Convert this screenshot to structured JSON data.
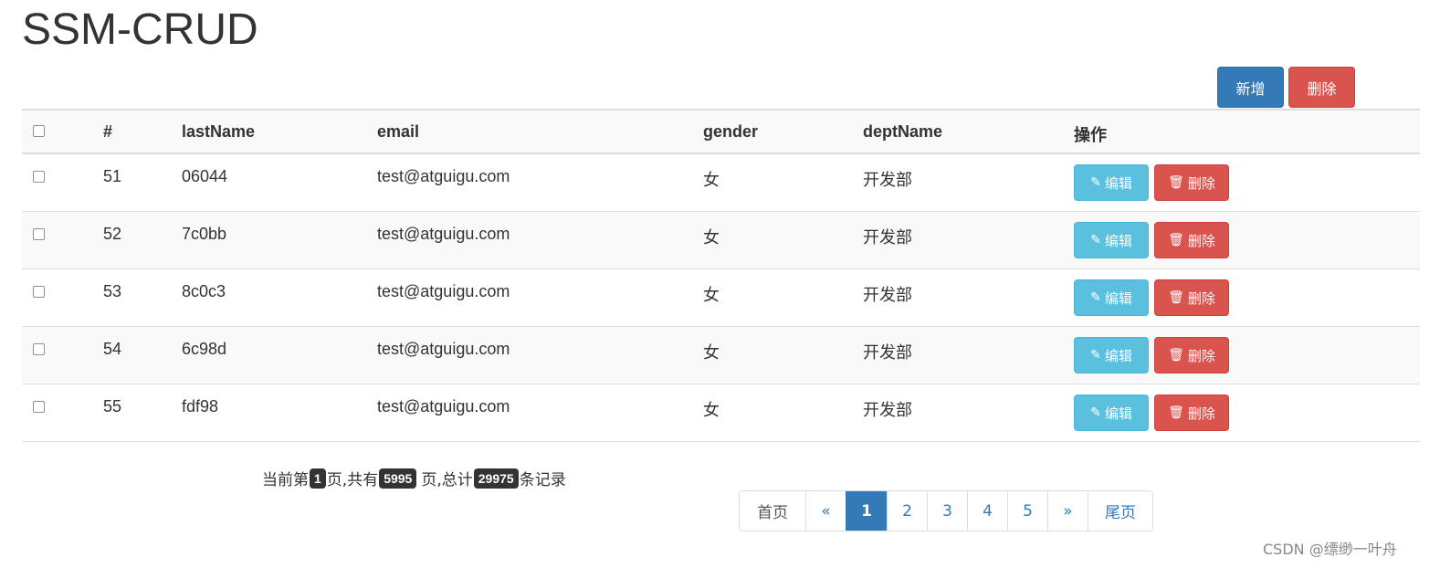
{
  "title": "SSM-CRUD",
  "toolbar": {
    "add_label": "新增",
    "delete_label": "删除"
  },
  "table": {
    "headers": [
      "#",
      "lastName",
      "email",
      "gender",
      "deptName",
      "操作"
    ],
    "rows": [
      {
        "id": "51",
        "lastName": "06044",
        "email": "test@atguigu.com",
        "gender": "女",
        "deptName": "开发部"
      },
      {
        "id": "52",
        "lastName": "7c0bb",
        "email": "test@atguigu.com",
        "gender": "女",
        "deptName": "开发部"
      },
      {
        "id": "53",
        "lastName": "8c0c3",
        "email": "test@atguigu.com",
        "gender": "女",
        "deptName": "开发部"
      },
      {
        "id": "54",
        "lastName": "6c98d",
        "email": "test@atguigu.com",
        "gender": "女",
        "deptName": "开发部"
      },
      {
        "id": "55",
        "lastName": "fdf98",
        "email": "test@atguigu.com",
        "gender": "女",
        "deptName": "开发部"
      }
    ],
    "edit_label": "编辑",
    "delete_label": "删除",
    "edit_icon": "pencil-icon",
    "delete_icon": "trash-icon"
  },
  "page_info": {
    "prefix": "当前第",
    "current": "1",
    "mid1": "页,共有",
    "total_pages": "5995",
    "mid2": "页,总计",
    "total_records": "29975",
    "suffix": "条记录"
  },
  "pagination": {
    "items": [
      "首页",
      "«",
      "1",
      "2",
      "3",
      "4",
      "5",
      "»",
      "尾页"
    ],
    "active": "1"
  },
  "watermark": "CSDN @缥缈一叶舟",
  "colors": {
    "primary": "#337ab7",
    "danger": "#d9534f",
    "info": "#5bc0de",
    "badge": "#333333"
  }
}
